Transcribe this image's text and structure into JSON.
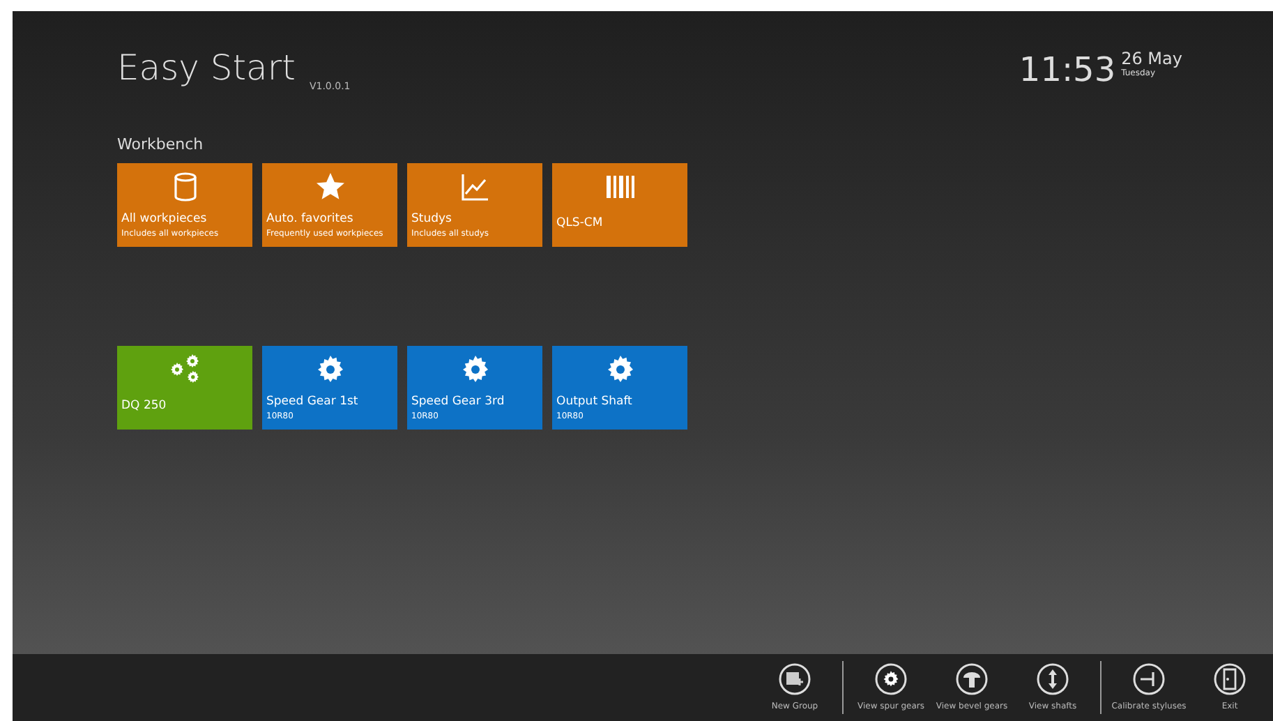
{
  "header": {
    "title": "Easy Start",
    "version": "V1.0.0.1",
    "time": "11:53",
    "date": "26 May",
    "weekday": "Tuesday"
  },
  "group": {
    "title": "Workbench"
  },
  "tiles": [
    {
      "title": "All workpieces",
      "subtitle": "Includes all workpieces",
      "color": "#d4720c"
    },
    {
      "title": "Auto. favorites",
      "subtitle": "Frequently used workpieces",
      "color": "#d4720c"
    },
    {
      "title": "Studys",
      "subtitle": "Includes all studys",
      "color": "#d4720c"
    },
    {
      "title": "QLS-CM",
      "color": "#d4720c"
    },
    {
      "title": "DQ 250",
      "color": "#5fa10f"
    },
    {
      "title": "Speed Gear 1st",
      "subtitle": "10R80",
      "color": "#0d72c6"
    },
    {
      "title": "Speed Gear 3rd",
      "subtitle": "10R80",
      "color": "#0d72c6"
    },
    {
      "title": "Output Shaft",
      "subtitle": "10R80",
      "color": "#0d72c6"
    }
  ],
  "app_bar": {
    "groups": [
      [
        "New Group"
      ],
      [
        "View spur gears",
        "View bevel gears",
        "View shafts"
      ],
      [
        "Calibrate styluses",
        "Exit"
      ]
    ]
  }
}
